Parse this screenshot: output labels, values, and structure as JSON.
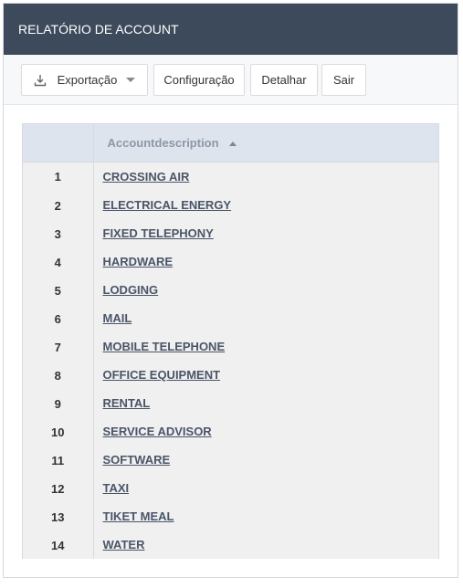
{
  "header": {
    "title": "RELATÓRIO DE ACCOUNT"
  },
  "toolbar": {
    "export_label": "Exportação",
    "config_label": "Configuração",
    "detail_label": "Detalhar",
    "exit_label": "Sair"
  },
  "table": {
    "column_header": "Accountdescription",
    "sort": "ascending",
    "rows": [
      {
        "num": "1",
        "desc": "CROSSING AIR"
      },
      {
        "num": "2",
        "desc": "ELECTRICAL ENERGY"
      },
      {
        "num": "3",
        "desc": "FIXED TELEPHONY"
      },
      {
        "num": "4",
        "desc": "HARDWARE"
      },
      {
        "num": "5",
        "desc": "LODGING"
      },
      {
        "num": "6",
        "desc": "MAIL"
      },
      {
        "num": "7",
        "desc": "MOBILE TELEPHONE"
      },
      {
        "num": "8",
        "desc": "OFFICE EQUIPMENT"
      },
      {
        "num": "9",
        "desc": "RENTAL"
      },
      {
        "num": "10",
        "desc": "SERVICE ADVISOR"
      },
      {
        "num": "11",
        "desc": "SOFTWARE"
      },
      {
        "num": "12",
        "desc": "TAXI"
      },
      {
        "num": "13",
        "desc": "TIKET MEAL"
      },
      {
        "num": "14",
        "desc": "WATER"
      }
    ]
  },
  "colors": {
    "header_bg": "#3d4a5c",
    "table_head_bg": "#dde4ed",
    "row_bg": "#f0f0f0",
    "link": "#4a5568"
  },
  "icons": {
    "export": "download-icon",
    "dropdown": "chevron-down-icon",
    "sort": "sort-ascending-icon"
  }
}
